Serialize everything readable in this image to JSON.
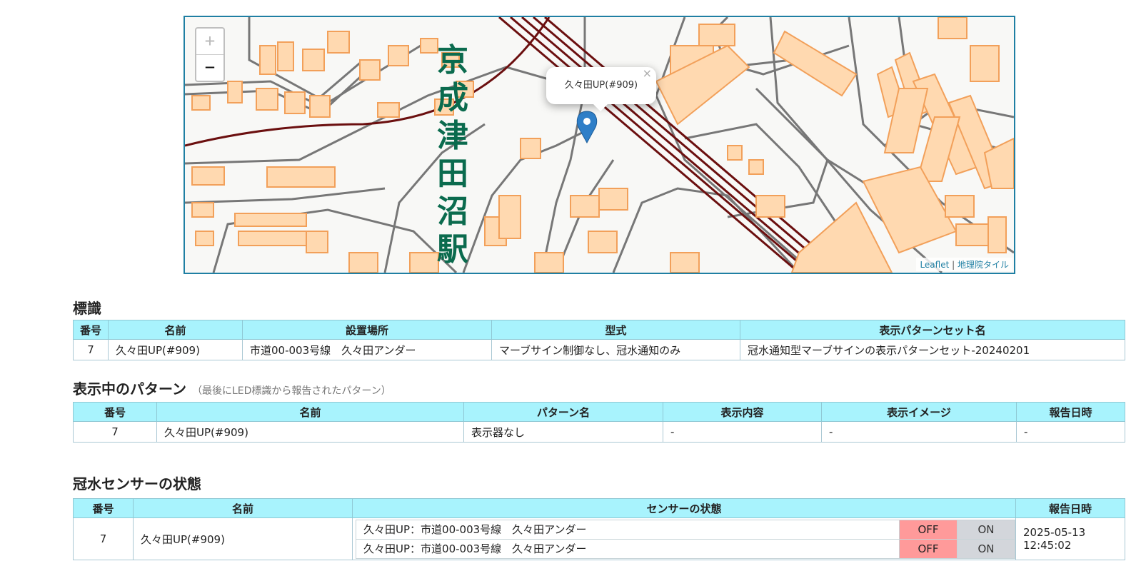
{
  "map": {
    "zoom_in": "+",
    "zoom_out": "−",
    "station_label": "京成津田沼駅",
    "popup_text": "久々田UP(#909)",
    "popup_close": "×",
    "attribution_leaflet": "Leaflet",
    "attribution_sep": " | ",
    "attribution_tiles": "地理院タイル"
  },
  "sign_section": {
    "title": "標識",
    "headers": [
      "番号",
      "名前",
      "設置場所",
      "型式",
      "表示パターンセット名"
    ],
    "row": [
      "7",
      "久々田UP(#909)",
      "市道00-003号線　久々田アンダー",
      "マーブサイン制御なし、冠水通知のみ",
      "冠水通知型マーブサインの表示パターンセット-20240201"
    ]
  },
  "pattern_section": {
    "title": "表示中のパターン",
    "subtitle": "（最後にLED標識から報告されたパターン）",
    "headers": [
      "番号",
      "名前",
      "パターン名",
      "表示内容",
      "表示イメージ",
      "報告日時"
    ],
    "row": [
      "7",
      "久々田UP(#909)",
      "表示器なし",
      "-",
      "-",
      "-"
    ]
  },
  "sensor_section": {
    "title": "冠水センサーの状態",
    "headers": [
      "番号",
      "名前",
      "センサーの状態",
      "報告日時"
    ],
    "number": "7",
    "name": "久々田UP(#909)",
    "sensors": [
      {
        "label": "久々田UP：市道00-003号線　久々田アンダー",
        "off": "OFF",
        "on": "ON"
      },
      {
        "label": "久々田UP：市道00-003号線　久々田アンダー",
        "off": "OFF",
        "on": "ON"
      }
    ],
    "reported_date": "2025-05-13",
    "reported_time": "12:45:02"
  }
}
